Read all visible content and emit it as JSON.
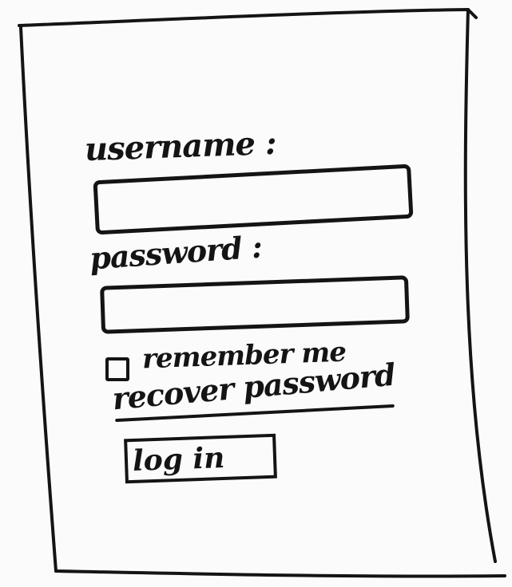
{
  "form": {
    "username_label": "username :",
    "username_value": "",
    "password_label": "password :",
    "password_value": "",
    "remember_label": "remember me",
    "remember_checked": false,
    "recover_link": "recover password",
    "login_button": "log in"
  }
}
